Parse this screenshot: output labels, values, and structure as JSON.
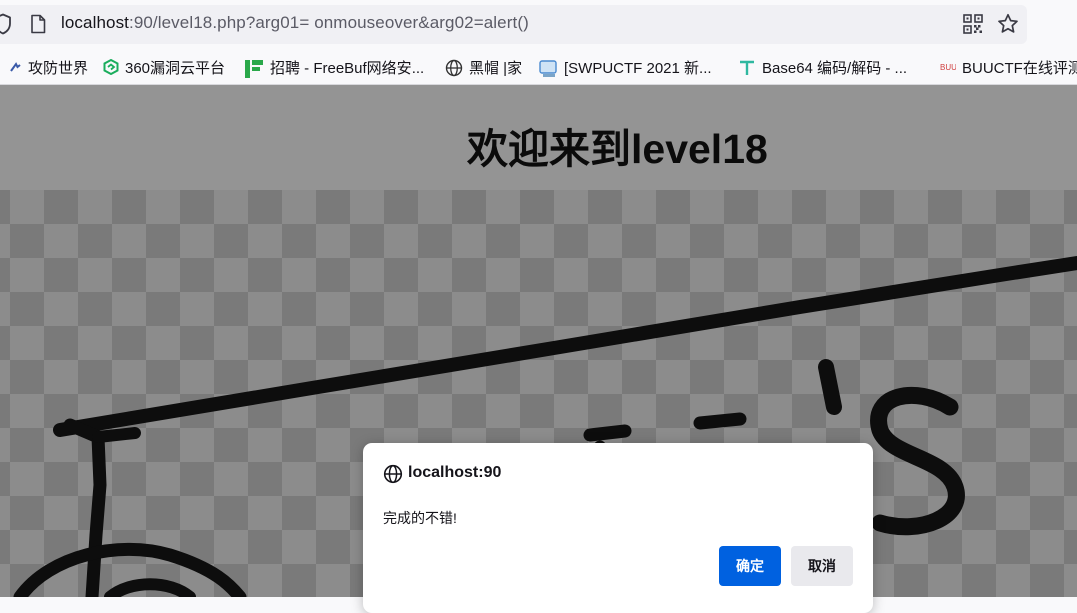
{
  "urlbar": {
    "host": "localhost",
    "rest": ":90/level18.php?arg01= onmouseover&arg02=alert()",
    "icons": [
      "shield-icon",
      "page-icon",
      "qr-code-icon",
      "star-icon"
    ]
  },
  "bookmarks": [
    {
      "label": "攻防世界",
      "icon": "adworld-icon",
      "color": "#3a5aa8"
    },
    {
      "label": "360漏洞云平台",
      "icon": "360-icon",
      "color": "#1aad5c"
    },
    {
      "label": "招聘 - FreeBuf网络安...",
      "icon": "freebuf-icon",
      "color": "#2aa84a"
    },
    {
      "label": "黑帽 |家",
      "icon": "globe-icon",
      "color": "#333333"
    },
    {
      "label": "[SWPUCTF 2021 新...",
      "icon": "nssctf-icon",
      "color": "#4a8ad0"
    },
    {
      "label": "Base64 编码/解码 - ...",
      "icon": "tool-icon",
      "color": "#2fb8a0"
    },
    {
      "label": "BUUCTF在线评测",
      "icon": "buuctf-icon",
      "color": "#d04040"
    }
  ],
  "page": {
    "title": "欢迎来到level18",
    "background": "#949494"
  },
  "dialog": {
    "host": "localhost:90",
    "message": "完成的不错!",
    "ok_label": "确定",
    "cancel_label": "取消",
    "accent": "#0061e0"
  }
}
